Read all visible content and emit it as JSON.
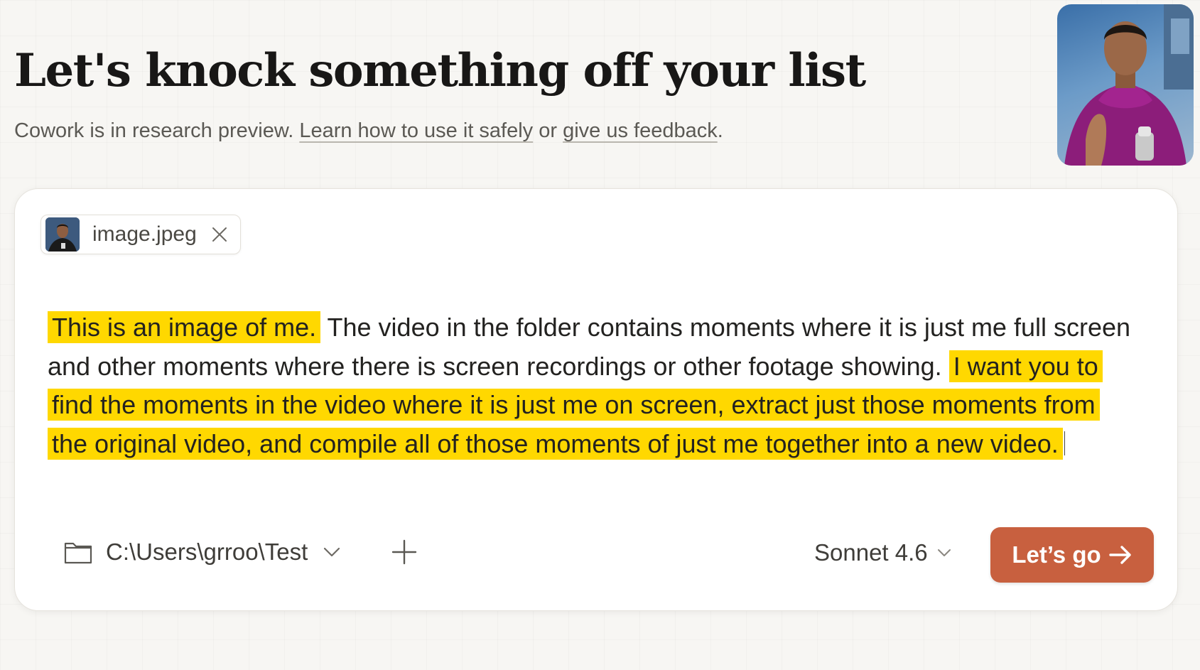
{
  "header": {
    "title": "Let's knock something off your list",
    "subtitle_prefix": "Cowork is in research preview. ",
    "link_safely": "Learn how to use it safely",
    "subtitle_or": " or ",
    "link_feedback": "give us feedback",
    "subtitle_end": "."
  },
  "attachment": {
    "filename": "image.jpeg"
  },
  "prompt": {
    "seg1": "This is an image of me.",
    "seg2": " The video in the folder contains moments where it is just me full screen and other moments where there is screen recordings or other footage showing. ",
    "seg3": "I want you to find the moments in the video where it is just me on screen, extract just those moments from the original video, and compile all of those moments of just me together into a new video."
  },
  "toolbar": {
    "folder_path": "C:\\Users\\grroo\\Test",
    "model": "Sonnet 4.6",
    "submit_label": "Let’s go"
  },
  "colors": {
    "accent": "#c8603f",
    "highlight": "#ffd800",
    "background": "#f7f6f3"
  },
  "icons": [
    "folder-icon",
    "chevron-down-icon",
    "plus-icon",
    "close-icon",
    "arrow-right-icon"
  ]
}
